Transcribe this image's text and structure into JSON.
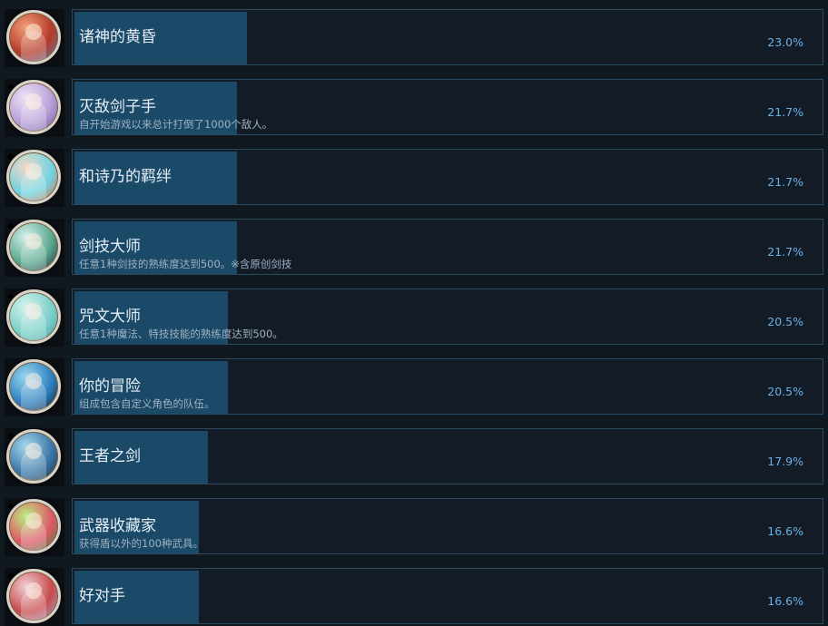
{
  "achievements": [
    {
      "title": "诸神的黄昏",
      "desc": "",
      "percent_label": "23.0%",
      "percent": 23.0,
      "colors": [
        "#f2a07a",
        "#b43a2a",
        "#5a7fb8"
      ],
      "sparkle": false
    },
    {
      "title": "灭敌剑子手",
      "desc": "自开始游戏以来总计打倒了1000个敌人。",
      "percent_label": "21.7%",
      "percent": 21.7,
      "colors": [
        "#ece4f4",
        "#b89fd8",
        "#6a5a9a"
      ],
      "sparkle": true
    },
    {
      "title": "和诗乃的羁绊",
      "desc": "",
      "percent_label": "21.7%",
      "percent": 21.7,
      "colors": [
        "#f5d8c8",
        "#6fd4e0",
        "#d86a4a"
      ],
      "sparkle": true
    },
    {
      "title": "剑技大师",
      "desc": "任意1种剑技的熟练度达到500。※含原创剑技",
      "percent_label": "21.7%",
      "percent": 21.7,
      "colors": [
        "#d8f0ec",
        "#5aa890",
        "#1a2a3a"
      ],
      "sparkle": true
    },
    {
      "title": "咒文大师",
      "desc": "任意1种魔法、特技技能的熟练度达到500。",
      "percent_label": "20.5%",
      "percent": 20.5,
      "colors": [
        "#d8f2f0",
        "#7ad0c8",
        "#4a9aa8"
      ],
      "sparkle": true
    },
    {
      "title": "你的冒险",
      "desc": "组成包含自定义角色的队伍。",
      "percent_label": "20.5%",
      "percent": 20.5,
      "colors": [
        "#9ad8f0",
        "#2f80c0",
        "#0a1a2c"
      ],
      "sparkle": false
    },
    {
      "title": "王者之剑",
      "desc": "",
      "percent_label": "17.9%",
      "percent": 17.9,
      "colors": [
        "#a8d8ec",
        "#3a78a8",
        "#1a2a40"
      ],
      "sparkle": true
    },
    {
      "title": "武器收藏家",
      "desc": "获得盾以外的100种武具。",
      "percent_label": "16.6%",
      "percent": 16.6,
      "colors": [
        "#b8f080",
        "#e05868",
        "#3a8a3a"
      ],
      "sparkle": true
    },
    {
      "title": "好对手",
      "desc": "",
      "percent_label": "16.6%",
      "percent": 16.6,
      "colors": [
        "#f0d0d8",
        "#c84a4a",
        "#9ab0d8"
      ],
      "sparkle": true
    }
  ]
}
